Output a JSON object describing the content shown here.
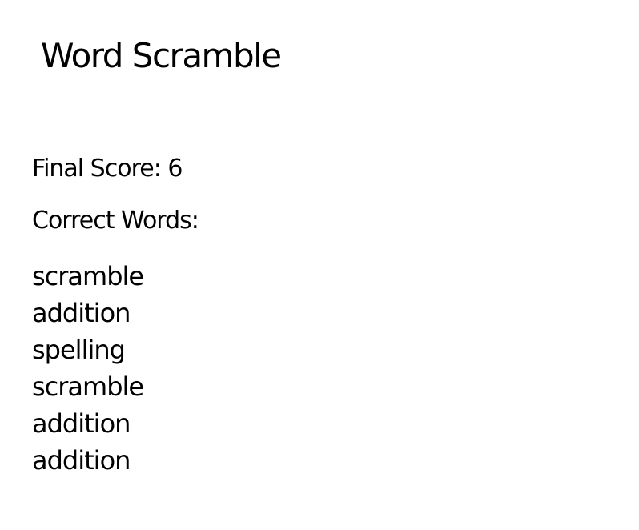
{
  "header": {
    "title": "Word Scramble"
  },
  "results": {
    "final_score_label": "Final Score: 6",
    "correct_words_label": "Correct Words:",
    "correct_words": [
      "scramble",
      "addition",
      "spelling",
      "scramble",
      "addition",
      "addition"
    ]
  },
  "colors": {
    "background": "#ffffff",
    "text": "#000000"
  }
}
